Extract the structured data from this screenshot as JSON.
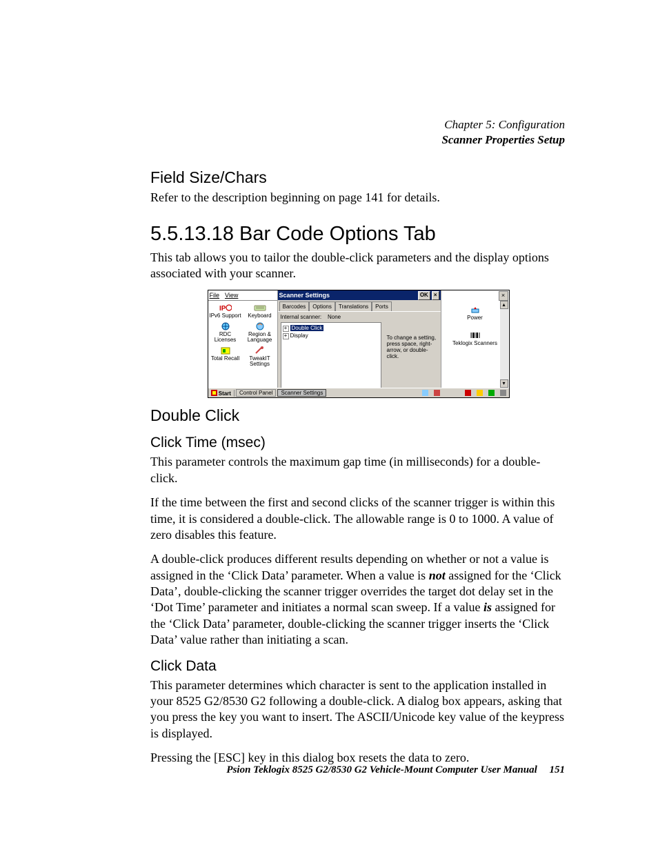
{
  "header": {
    "chapter": "Chapter 5: Configuration",
    "section": "Scanner Properties Setup"
  },
  "h_field_size": "Field Size/Chars",
  "p_field_size": "Refer to the description beginning on page 141 for details.",
  "h_barcode": "5.5.13.18 Bar Code Options Tab",
  "p_barcode": "This tab allows you to tailor the double-click parameters and the display options associated with your scanner.",
  "screenshot": {
    "cp_menu": {
      "file": "File",
      "view": "View"
    },
    "cp_icons": {
      "ipv6": "IPv6 Support",
      "keyboard": "Keyboard",
      "rdc": "RDC Licenses",
      "region": "Region & Language",
      "totalrecall": "Total Recall",
      "tweakit": "TweakIT Settings"
    },
    "settings_title": "Scanner Settings",
    "ok": "OK",
    "close": "×",
    "tabs": {
      "barcodes": "Barcodes",
      "options": "Options",
      "translations": "Translations",
      "ports": "Ports"
    },
    "internal_scanner_label": "Internal scanner:",
    "internal_scanner_value": "None",
    "tree": {
      "double_click": "Double Click",
      "display": "Display"
    },
    "hint": "To change a setting, press space, right-arrow, or double-click.",
    "right_icons": {
      "power": "Power",
      "scanners": "Teklogix Scanners"
    },
    "taskbar": {
      "start": "Start",
      "control_panel": "Control Panel",
      "scanner_settings": "Scanner Settings"
    }
  },
  "h_double_click": "Double Click",
  "h_click_time": "Click Time (msec)",
  "p_click_time_1": "This parameter controls the maximum gap time (in milliseconds) for a double-click.",
  "p_click_time_2": "If the time between the first and second clicks of the scanner trigger is within this time, it is considered a double-click. The allowable range is 0 to 1000. A value of zero disables this feature.",
  "p_click_time_3a": "A double-click produces different results depending on whether or not a value is assigned in the ‘Click Data’ parameter. When a value is ",
  "p_click_time_3_not": "not",
  "p_click_time_3b": " assigned for the ‘Click Data’, double-clicking the scanner trigger overrides the target dot delay set in the ‘Dot Time’ parameter and initiates a normal scan sweep. If a value ",
  "p_click_time_3_is": "is",
  "p_click_time_3c": " assigned for the ‘Click Data’ parameter, double-clicking the scanner trigger inserts the ‘Click Data’ value rather than initiating a scan.",
  "h_click_data": "Click Data",
  "p_click_data_1": "This parameter determines which character is sent to the application installed in your 8525 G2/8530 G2 following a double-click. A dialog box appears, asking that you press the key you want to insert. The ASCII/Unicode key value of the keypress is displayed.",
  "p_click_data_2": "Pressing the [ESC] key in this dialog box resets the data to zero.",
  "footer": {
    "manual": "Psion Teklogix 8525 G2/8530 G2 Vehicle-Mount Computer User Manual",
    "page": "151"
  }
}
